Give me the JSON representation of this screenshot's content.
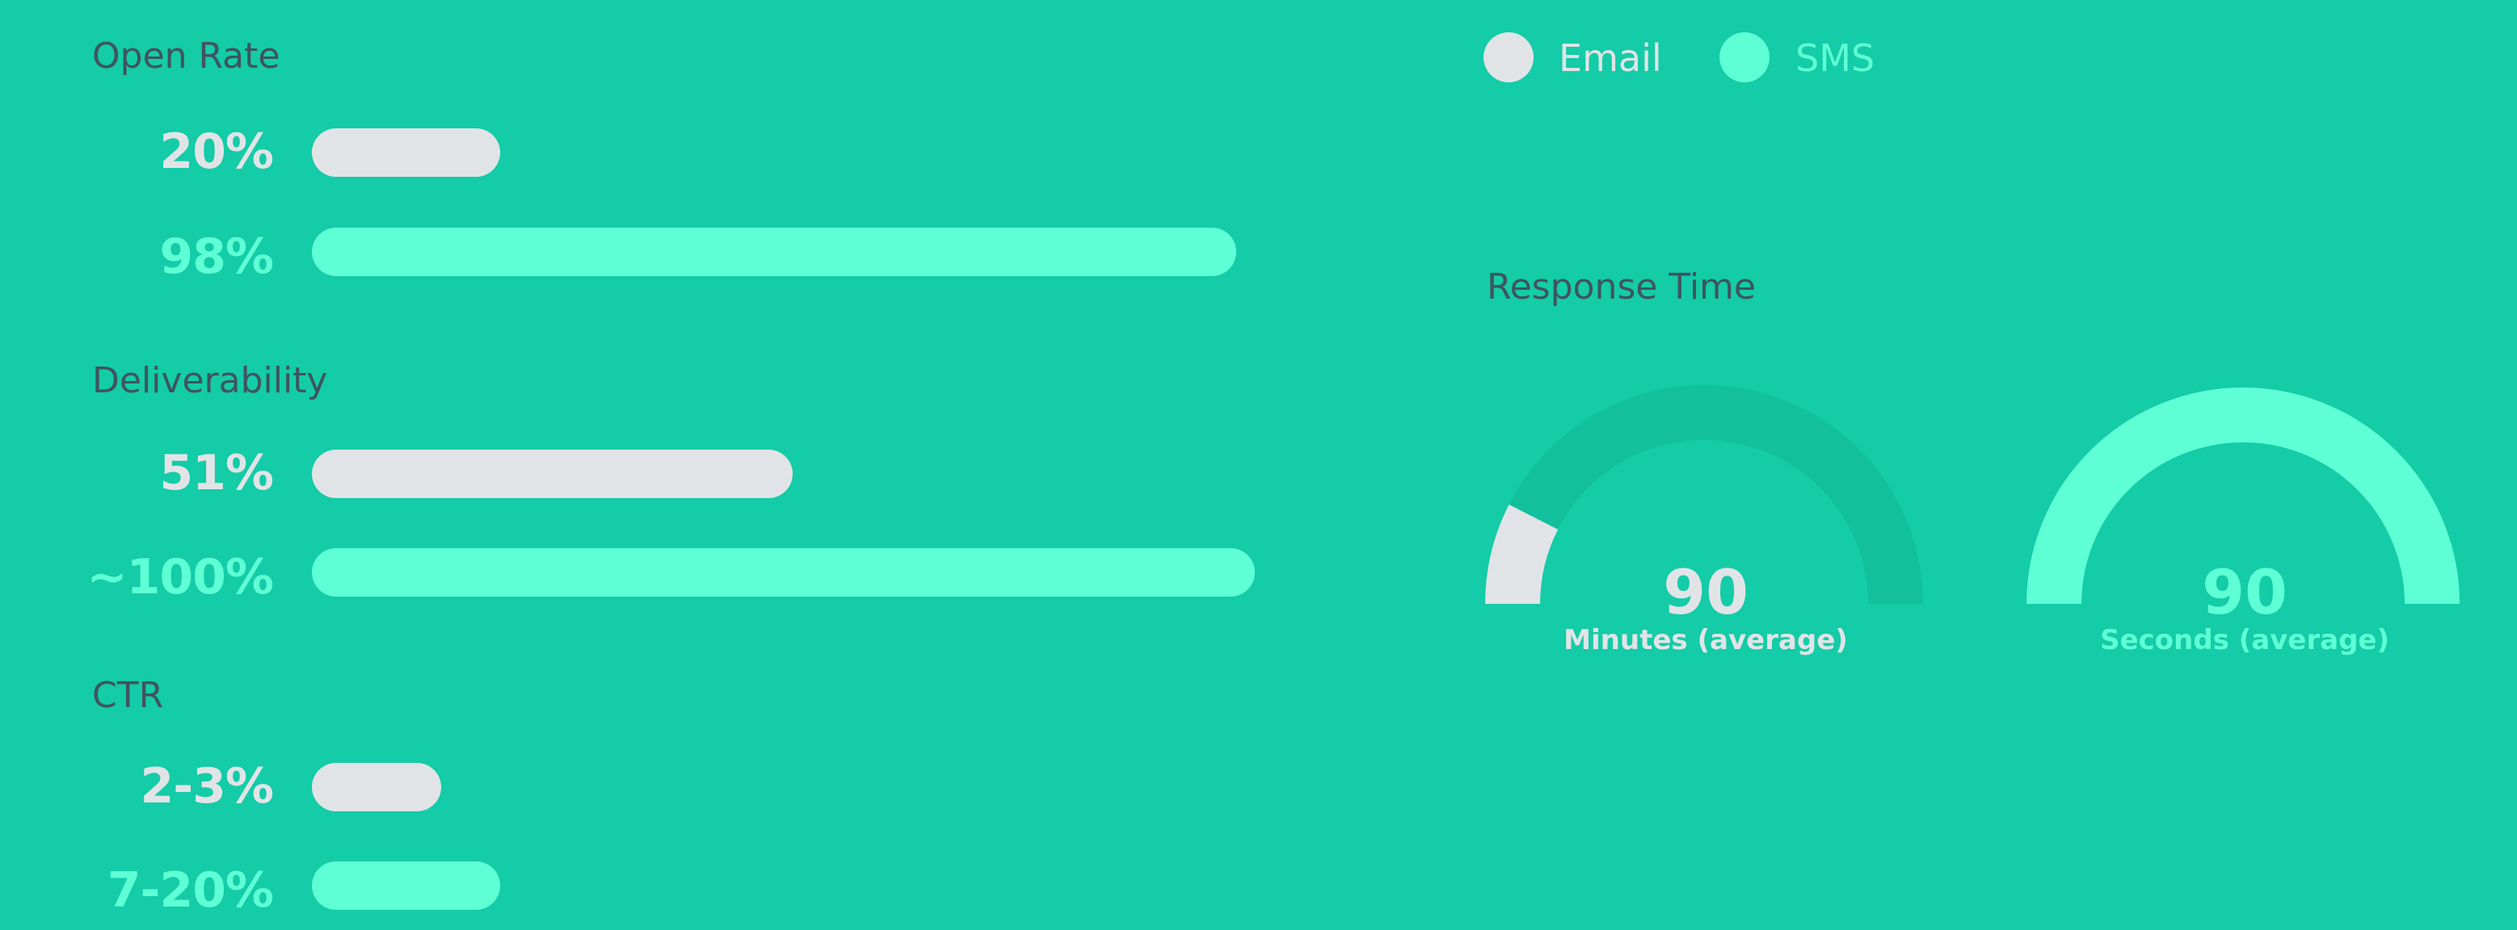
{
  "colors": {
    "background": "#14cca7",
    "email": "#e1e4e7",
    "sms": "#5fffd5",
    "title_text": "#3f5461",
    "gauge_track": "#13c09d"
  },
  "legend": {
    "email": "Email",
    "sms": "SMS"
  },
  "response_time": {
    "title": "Response Time",
    "email_value": "90",
    "email_caption": "Minutes (average)",
    "sms_value": "90",
    "sms_caption": "Seconds (average)"
  },
  "chart_data": [
    {
      "type": "bar",
      "orientation": "horizontal",
      "groups": [
        {
          "title": "Open Rate",
          "bars": [
            {
              "series": "Email",
              "label": "20%",
              "value": 20
            },
            {
              "series": "SMS",
              "label": "98%",
              "value": 98
            }
          ]
        },
        {
          "title": "Deliverability",
          "bars": [
            {
              "series": "Email",
              "label": "51%",
              "value": 51
            },
            {
              "series": "SMS",
              "label": "~100%",
              "value": 100
            }
          ]
        },
        {
          "title": "CTR",
          "bars": [
            {
              "series": "Email",
              "label": "2-3%",
              "value": 3
            },
            {
              "series": "SMS",
              "label": "7-20%",
              "value": 20
            }
          ]
        }
      ],
      "series": [
        {
          "name": "Email",
          "color": "#e1e4e7"
        },
        {
          "name": "SMS",
          "color": "#5fffd5"
        }
      ]
    },
    {
      "type": "gauge",
      "title": "Response Time",
      "gauges": [
        {
          "series": "Email",
          "value": 90,
          "caption": "Minutes (average)",
          "fill_fraction": 0.15
        },
        {
          "series": "SMS",
          "value": 90,
          "caption": "Seconds (average)",
          "fill_fraction": 1.0
        }
      ]
    }
  ]
}
